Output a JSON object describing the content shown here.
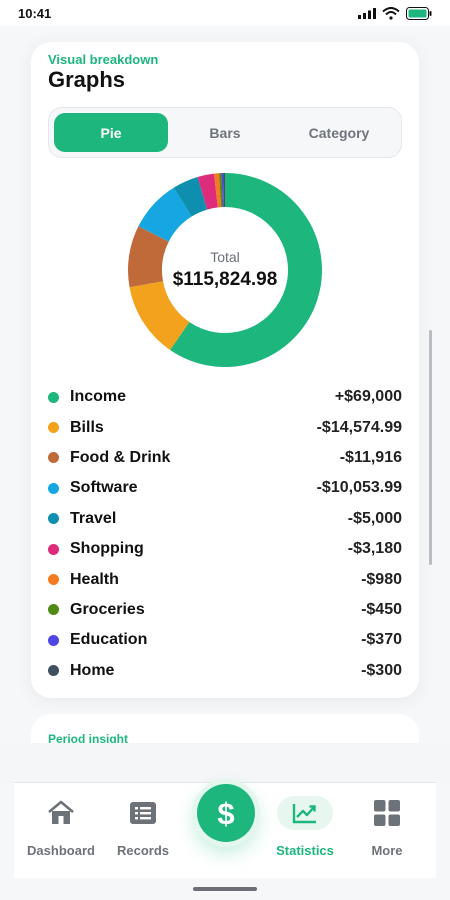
{
  "status_bar": {
    "time": "10:41"
  },
  "graphs_card": {
    "subtitle": "Visual breakdown",
    "title": "Graphs",
    "tabs": [
      {
        "label": "Pie",
        "active": true
      },
      {
        "label": "Bars",
        "active": false
      },
      {
        "label": "Category",
        "active": false
      }
    ],
    "donut": {
      "label": "Total",
      "total": "$115,824.98"
    },
    "legend": [
      {
        "name": "Income",
        "amount": "+$69,000",
        "value": 69000,
        "color": "#1db67d"
      },
      {
        "name": "Bills",
        "amount": "-$14,574.99",
        "value": 14574.99,
        "color": "#f2a21c"
      },
      {
        "name": "Food & Drink",
        "amount": "-$11,916",
        "value": 11916,
        "color": "#c06a3a"
      },
      {
        "name": "Software",
        "amount": "-$10,053.99",
        "value": 10053.99,
        "color": "#16a7e2"
      },
      {
        "name": "Travel",
        "amount": "-$5,000",
        "value": 5000,
        "color": "#0f8fb0"
      },
      {
        "name": "Shopping",
        "amount": "-$3,180",
        "value": 3180,
        "color": "#dd2c7b"
      },
      {
        "name": "Health",
        "amount": "-$980",
        "value": 980,
        "color": "#f47a21"
      },
      {
        "name": "Groceries",
        "amount": "-$450",
        "value": 450,
        "color": "#4f8a13"
      },
      {
        "name": "Education",
        "amount": "-$370",
        "value": 370,
        "color": "#5146e5"
      },
      {
        "name": "Home",
        "amount": "-$300",
        "value": 300,
        "color": "#3f5061"
      }
    ]
  },
  "next_card": {
    "subtitle": "Period insight"
  },
  "tabbar": {
    "items": [
      {
        "label": "Dashboard",
        "icon": "home-icon"
      },
      {
        "label": "Records",
        "icon": "receipt-icon"
      },
      {
        "label": "Statistics",
        "icon": "trend-chart-icon",
        "active": true
      },
      {
        "label": "More",
        "icon": "grid-icon"
      }
    ],
    "fab_symbol": "$"
  },
  "colors": {
    "accent": "#1db67d"
  }
}
